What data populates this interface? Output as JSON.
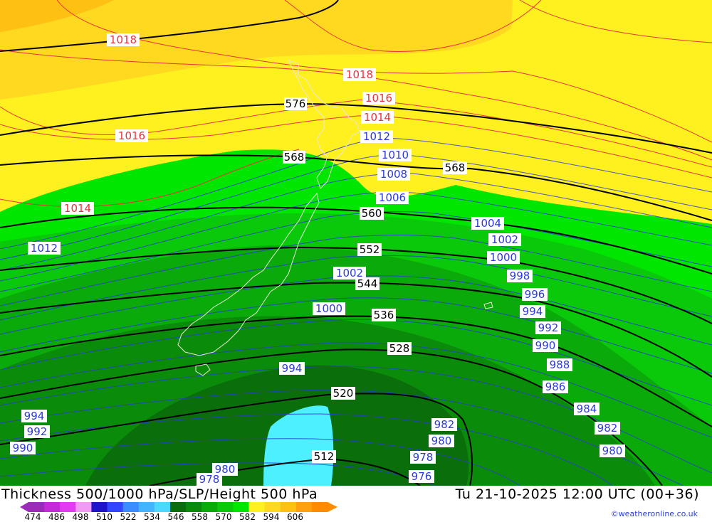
{
  "title": "Thickness 500/1000 hPa/SLP/Height 500 hPa",
  "valid_time": "Tu 21-10-2025 12:00 UTC (00+36)",
  "credit": "©weatheronline.co.uk",
  "colors": {
    "slp_high": "#e8343c",
    "slp_low": "#2b3bd6",
    "height": "#000000",
    "coast": "#e8e8d8"
  },
  "color_scale": {
    "ticks": [
      "474",
      "486",
      "498",
      "510",
      "522",
      "534",
      "546",
      "558",
      "570",
      "582",
      "594",
      "606"
    ],
    "colors": [
      "#9c2bb8",
      "#c32ad8",
      "#e23cf0",
      "#f39af4",
      "#1e14c8",
      "#3246ff",
      "#3c8cff",
      "#44b4ff",
      "#4cd8ff",
      "#0a6e0a",
      "#0a8c0a",
      "#0aaa0a",
      "#0ac80a",
      "#00e600",
      "#fff020",
      "#ffd820",
      "#ffc014",
      "#ffa010",
      "#ff8c00"
    ]
  },
  "height_labels": [
    {
      "text": "576"
    },
    {
      "text": "568"
    },
    {
      "text": "568"
    },
    {
      "text": "560"
    },
    {
      "text": "552"
    },
    {
      "text": "544"
    },
    {
      "text": "536"
    },
    {
      "text": "528"
    },
    {
      "text": "520"
    },
    {
      "text": "512"
    }
  ],
  "slp_labels_high": [
    {
      "text": "1018"
    },
    {
      "text": "1018"
    },
    {
      "text": "1016"
    },
    {
      "text": "1016"
    },
    {
      "text": "1014"
    },
    {
      "text": "1014"
    }
  ],
  "slp_labels_low": [
    {
      "text": "1012"
    },
    {
      "text": "1010"
    },
    {
      "text": "1008"
    },
    {
      "text": "1006"
    },
    {
      "text": "1004"
    },
    {
      "text": "1002"
    },
    {
      "text": "1000"
    },
    {
      "text": "998"
    },
    {
      "text": "996"
    },
    {
      "text": "994"
    },
    {
      "text": "992"
    },
    {
      "text": "990"
    },
    {
      "text": "988"
    },
    {
      "text": "986"
    },
    {
      "text": "984"
    },
    {
      "text": "982"
    },
    {
      "text": "980"
    },
    {
      "text": "1012"
    },
    {
      "text": "1002"
    },
    {
      "text": "1000"
    },
    {
      "text": "994"
    },
    {
      "text": "994"
    },
    {
      "text": "992"
    },
    {
      "text": "990"
    },
    {
      "text": "982"
    },
    {
      "text": "980"
    },
    {
      "text": "978"
    },
    {
      "text": "976"
    },
    {
      "text": "980"
    },
    {
      "text": "978"
    }
  ]
}
